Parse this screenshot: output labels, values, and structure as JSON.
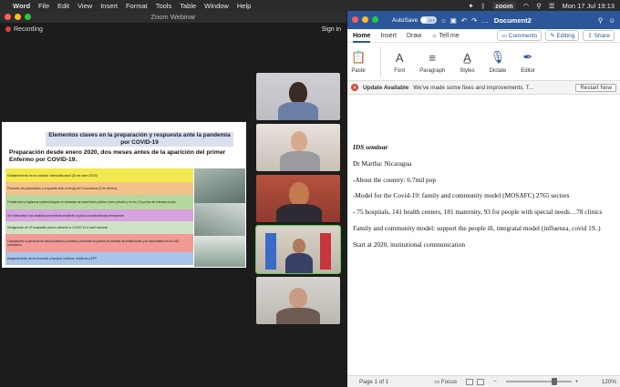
{
  "menubar": {
    "app": "Word",
    "items": [
      "File",
      "Edit",
      "View",
      "Insert",
      "Format",
      "Tools",
      "Table",
      "Window",
      "Help"
    ],
    "zoom_badge": "zoom",
    "datetime": "Mon 17 Jul  19:13"
  },
  "zoom": {
    "window_title": "Zoom Webinar",
    "recording_label": "Recording",
    "signin_label": "Sign in",
    "slide": {
      "header": "Elementos claves en la preparación y respuesta ante la pandemia por COVID-19",
      "subheader": "Preparación desde enero 2020, dos meses antes de la aparición del primer Enfermo por COVID-19.",
      "rows": [
        {
          "text": "Establecimiento de la comisión interinstitucional (30 de enero 2020)",
          "color": "#f2e94e"
        },
        {
          "text": "Protocolo de preparación y respuesta ante el riesgo del Coronavirus (9 de febrero)",
          "color": "#f4c38c"
        },
        {
          "text": "Fortalecida la vigilancia epidemiológica en unidades de salud tanto público como privado y en los 13 puntos de entrada al país",
          "color": "#b5d99c"
        },
        {
          "text": "Se fortalecieron las medidas preventivas mediante un plan comunicacional permanente",
          "color": "#d6a2e0"
        },
        {
          "text": "Designación de 19 hospitales para la atención a COVID-19 a nivel nacional",
          "color": "#cfe3c4"
        },
        {
          "text": "Capacitación a personal de salud públicos y privados, personal en puntos de entrada de instituciones y la comunitaria en los 153 municipios",
          "color": "#f19a96"
        },
        {
          "text": "Aseguramiento de los insumos y equipos médicos, reactivos y EPP",
          "color": "#a9c4ea"
        }
      ]
    },
    "participants": 5
  },
  "word": {
    "autosave_label": "AutoSave",
    "autosave_state": "OFF",
    "doc_title": "Document2",
    "tabs": [
      "Home",
      "Insert",
      "Draw"
    ],
    "tell_me": "Tell me",
    "comments_btn": "Comments",
    "editing_btn": "Editing",
    "share_btn": "Share",
    "ribbon": {
      "paste": "Paste",
      "font": "Font",
      "paragraph": "Paragraph",
      "styles": "Styles",
      "dictate": "Dictate",
      "editor": "Editor"
    },
    "update": {
      "title": "Update Available",
      "message": "We've made some fixes and improvements. T...",
      "button": "Restart Now"
    },
    "document_lines": [
      "IDS seminar",
      "Dr Martha: Nicaragua",
      "-About the country: 6.7mil pop",
      "-Model for the Covid-19: family and community model (MOSAFC) 2765 sectors",
      "- 75 hospitals, 141 health centers, 181 maternity, 93 for people with special needs…78 clinics",
      "Family and community model: support the people ill, integratal model (influenza, covid 19..)",
      "Start at 2020, institutional communication"
    ],
    "status": {
      "page": "Page 1 of 1",
      "focus": "Focus",
      "zoom": "120%"
    }
  }
}
